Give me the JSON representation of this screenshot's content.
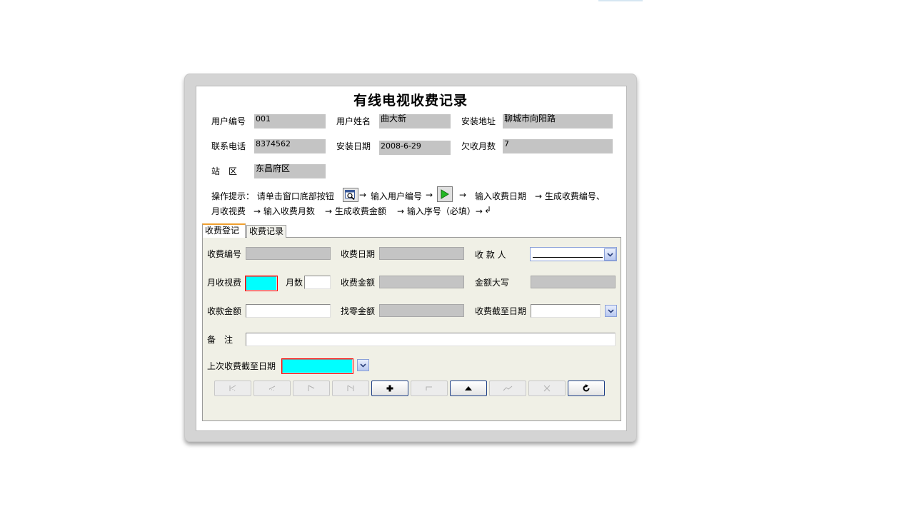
{
  "form": {
    "title": "有线电视收费记录",
    "user_id_label": "用户编号",
    "user_id_value": "001",
    "user_name_label": "用户姓名",
    "user_name_value": "曲大新",
    "address_label": "安装地址",
    "address_value": "聊城市向阳路",
    "phone_label": "联系电话",
    "phone_value": "8374562",
    "install_date_label": "安装日期",
    "install_date_value": "2008-6-29",
    "owed_months_label": "欠收月数",
    "owed_months_value": "7",
    "station_label": "站　区",
    "station_value": "东昌府区"
  },
  "hint": {
    "line1_prefix": "操作提示：  请单击窗口底部按钮",
    "arrow": "→",
    "line1_mid": "输入用户编号",
    "line1_end": "输入收费日期",
    "line1_tail": "→ 生成收费编号、",
    "line2_a": "月收视费",
    "line2_b": "→  输入收费月数",
    "line2_c": "→ 生成收费金额",
    "line2_d": "→  输入序号（必填）→",
    "enter_symbol": "↲"
  },
  "tabs": [
    {
      "label": "收费登记"
    },
    {
      "label": "收费记录"
    }
  ],
  "entry": {
    "fee_no_label": "收费编号",
    "fee_date_label": "收费日期",
    "collector_label": "收 款 人",
    "monthly_fee_label": "月收视费",
    "months_label": "月数",
    "amount_label": "收费金额",
    "amount_caps_label": "金额大写",
    "received_label": "收款金额",
    "change_label": "找零金额",
    "paid_until_label": "收费截至日期",
    "remark_label": "备　注",
    "last_paid_until_label": "上次收费截至日期"
  },
  "icons": {
    "preview": "magnifier-window-icon",
    "run": "green-play-icon",
    "dropdown": "chevron-down-icon",
    "first": "first-record-icon",
    "prev": "previous-record-icon",
    "next": "next-record-icon",
    "last": "last-record-icon",
    "add": "plus-icon",
    "edit": "edit-icon",
    "save": "up-triangle-icon",
    "undo": "undo-icon",
    "delete": "delete-icon",
    "refresh": "refresh-icon"
  },
  "colors": {
    "required_field": "#00ffff",
    "readonly_field": "#c4c4c4",
    "tab_accent": "#f0a030"
  }
}
